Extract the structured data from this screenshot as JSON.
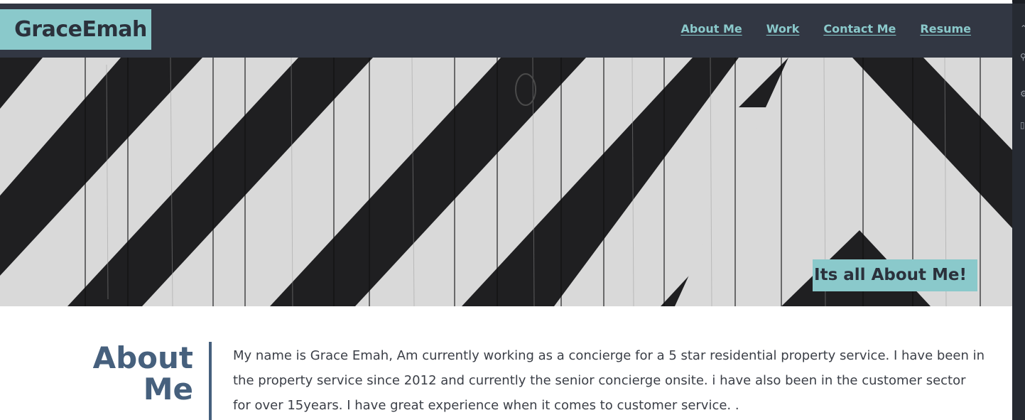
{
  "header": {
    "brand": "GraceEmah",
    "nav": [
      {
        "label": "About Me"
      },
      {
        "label": "Work"
      },
      {
        "label": "Contact Me"
      },
      {
        "label": "Resume"
      }
    ]
  },
  "hero": {
    "image": "black-and-white-chevron-wood-planks",
    "tagline": "Its all About Me!"
  },
  "about": {
    "title_line1": "About",
    "title_line2": "Me",
    "text": "My name is Grace Emah, Am currently working as a concierge for a 5 star residential property service. I have been in the property service since 2012 and currently the senior concierge onsite. i have also been in the customer sector for over 15years. I have great experience when it comes to customer service. ."
  },
  "colors": {
    "accent": "#8ac9cb",
    "header_bg": "#323743",
    "heading": "#46607d"
  }
}
